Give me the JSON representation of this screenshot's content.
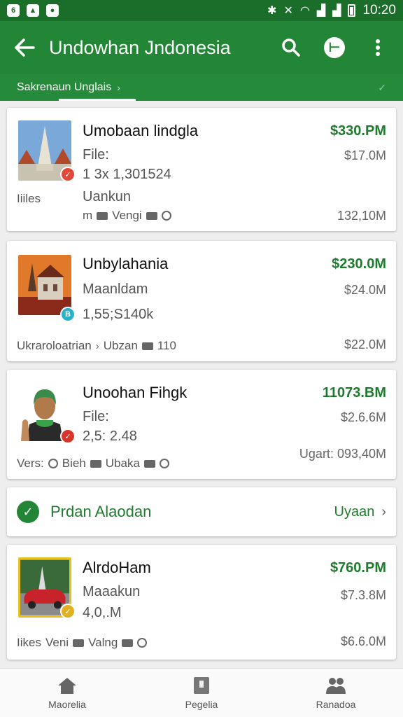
{
  "status_bar": {
    "time": "10:20"
  },
  "app_bar": {
    "title": "Undowhan Jndonesia"
  },
  "tabs": [
    {
      "label": "Sakrenaun Unglais"
    }
  ],
  "cards": [
    {
      "title": "Umobaan lindgla",
      "line1": "File:",
      "line2": "1 3x 1,301524",
      "line3": "Uankun",
      "footer_left": "Iiiles",
      "footer_a": "m",
      "footer_b": "Vengi",
      "price": "$330.PM",
      "value1": "$17.0M",
      "value2": "132,10M",
      "badge": "✓"
    },
    {
      "title": "Unbylahania",
      "line1": "Maanldam",
      "line2": "1,55;S140k",
      "footer_left": "Ukraroloatrian",
      "footer_a": "Ubzan",
      "footer_b": "110",
      "price": "$230.0M",
      "value1": "$24.0M",
      "value2": "$22.0M",
      "badge": "B"
    },
    {
      "title": "Unoohan Fihgk",
      "line1": "File:",
      "line2": "2,5: 2.48",
      "footer_left": "Vers:",
      "footer_a": "Bieh",
      "footer_b": "Ubaka",
      "price": "11073.BM",
      "value1": "$2.6.6M",
      "value2": "Ugart: 093,40M",
      "badge": "✓"
    },
    {
      "title": "AlrdoHam",
      "line1": "Maaakun",
      "line2": "4,0,.M",
      "footer_left": "Iikes",
      "footer_a": "Veni",
      "footer_b": "Valng",
      "price": "$760.PM",
      "value1": "$7.3.8M",
      "value2": "$6.6.0M",
      "badge": "✓"
    }
  ],
  "banner": {
    "label": "Prdan Alaodan",
    "action": "Uyaan"
  },
  "bottom_nav": [
    {
      "label": "Maorelia",
      "icon": "home-icon"
    },
    {
      "label": "Pegelia",
      "icon": "book-icon"
    },
    {
      "label": "Ranadoa",
      "icon": "people-icon"
    }
  ],
  "colors": {
    "primary": "#238636",
    "status_bar": "#1b6e2a",
    "price": "#1e7b2e"
  }
}
